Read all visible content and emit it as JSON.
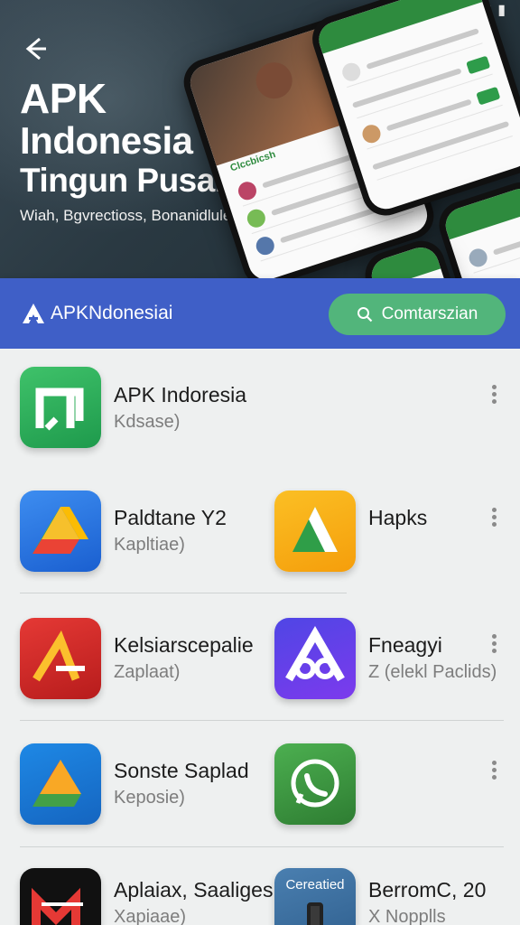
{
  "status": {
    "icons": [
      "settings-icon",
      "signal-icon",
      "battery-icon"
    ]
  },
  "hero": {
    "title_line1": "APK",
    "title_line2": "Indonesia",
    "title_line3": "Tingun Pusam",
    "subtitle": "Wiah, Bgvrectioss, Bonanidlulelai",
    "phone_caption": "Clccbicsh"
  },
  "appbar": {
    "brand": "APKNdonesiai",
    "cta_label": "Comtarszian"
  },
  "colors": {
    "accent_blue": "#3f5fc7",
    "cta_green": "#52b57b"
  },
  "apps": [
    {
      "name": "APK Indoresia",
      "sub": "Kdsase)"
    },
    {
      "name": "Paldtane Y2",
      "sub": "Kapltiae)"
    },
    {
      "name": "Hapks",
      "sub": ""
    },
    {
      "name": "Kelsiarscepalie",
      "sub": "Zaplaat)"
    },
    {
      "name": "Fneagyi",
      "sub": "Z (elekl Paclids)"
    },
    {
      "name": "Sonste Saplad",
      "sub": "Keposie)"
    },
    {
      "name": "Aplaiax, Saaliges",
      "sub": "Xapiaae)"
    },
    {
      "name": "BerromC, 20",
      "sub": "X Nopplls"
    },
    {
      "name": "Cereatied",
      "sub": ""
    }
  ]
}
